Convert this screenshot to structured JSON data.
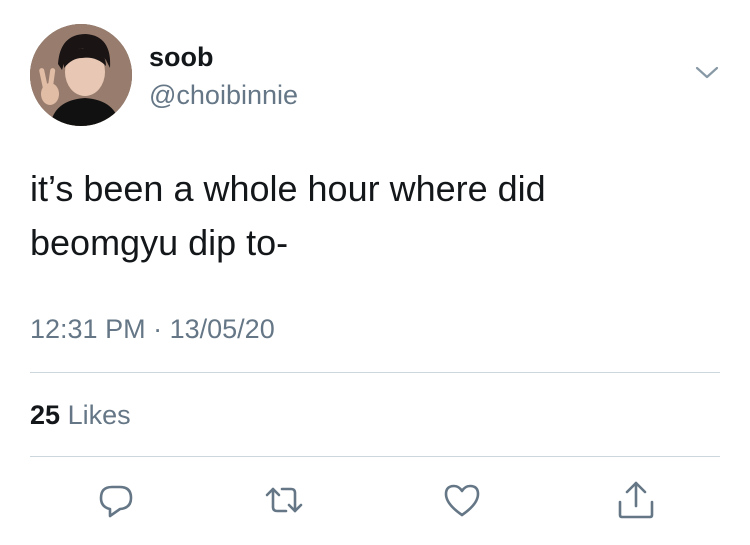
{
  "user": {
    "display_name": "soob",
    "handle": "@choibinnie",
    "avatar_icon": "profile-photo"
  },
  "tweet": {
    "text_lines": [
      "it’s been a whole hour where did",
      "beomgyu dip to-"
    ],
    "time": "12:31 PM",
    "separator": "·",
    "date": "13/05/20"
  },
  "stats": {
    "likes_count": "25",
    "likes_label": "Likes"
  },
  "actions": {
    "reply_icon": "reply-icon",
    "retweet_icon": "retweet-icon",
    "like_icon": "heart-icon",
    "share_icon": "share-icon",
    "menu_icon": "chevron-down-icon"
  },
  "colors": {
    "text_primary": "#14171a",
    "text_secondary": "#657786",
    "icon": "#657786",
    "divider": "#ccd6dd"
  }
}
